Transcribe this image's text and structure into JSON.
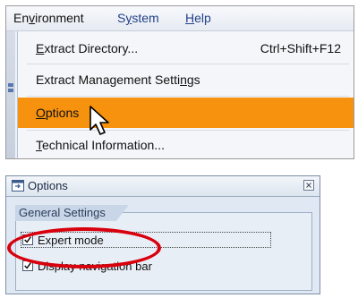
{
  "menubar": {
    "items": [
      {
        "label_pre": "En",
        "label_u": "v",
        "label_post": "ironment"
      },
      {
        "label_pre": "S",
        "label_u": "y",
        "label_post": "stem"
      },
      {
        "label_pre": "",
        "label_u": "H",
        "label_post": "elp"
      }
    ]
  },
  "dropdown": {
    "items": [
      {
        "label_pre": "",
        "label_u": "E",
        "label_post": "xtract Directory...",
        "accel": "Ctrl+Shift+F12"
      },
      {
        "label_pre": "Extract Management Setti",
        "label_u": "n",
        "label_post": "gs",
        "accel": ""
      },
      {
        "label_pre": "",
        "label_u": "O",
        "label_post": "ptions",
        "accel": ""
      },
      {
        "label_pre": "",
        "label_u": "T",
        "label_post": "echnical Information...",
        "accel": ""
      }
    ],
    "selected_index": 2,
    "selected_color": "#f7920f"
  },
  "dialog": {
    "title": "Options",
    "group_title": "General Settings",
    "checkboxes": [
      {
        "label": "Expert mode",
        "checked": true
      },
      {
        "label": "Display navigation bar",
        "checked": true
      }
    ]
  },
  "annotation": {
    "color": "#d8000c"
  },
  "icons": {
    "cursor": "mouse-pointer-icon",
    "dialog": "window-icon",
    "close": "close-icon"
  }
}
